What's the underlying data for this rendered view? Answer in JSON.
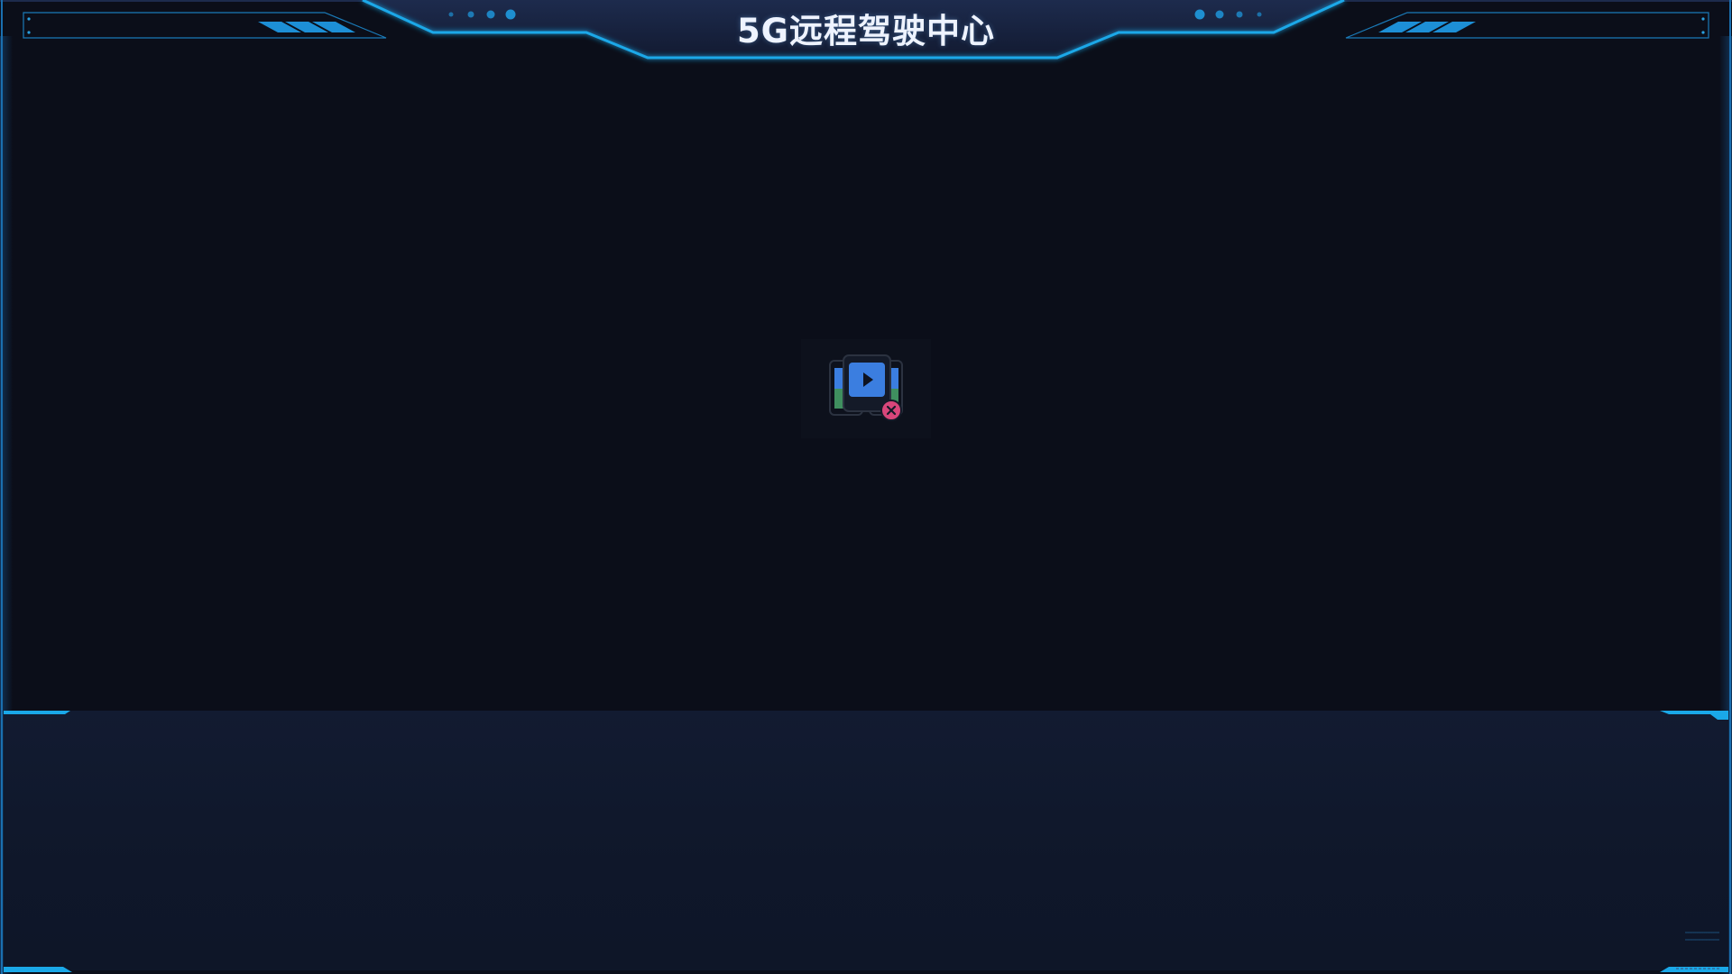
{
  "header": {
    "title": "5G远程驾驶中心"
  },
  "video": {
    "icon": "video-unavailable-icon"
  },
  "colors": {
    "background": "#0b0e19",
    "accent": "#1aa8e8",
    "header_fill": "#172341",
    "bottom_panel": "#0f172a",
    "error_badge": "#d8467a",
    "play_blue": "#3b7ee0",
    "green": "#3f8f5f"
  }
}
